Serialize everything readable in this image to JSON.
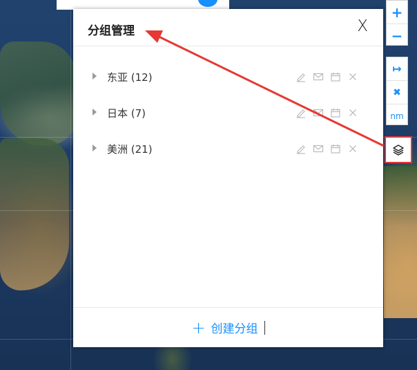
{
  "panel": {
    "title": "分组管理",
    "close_label": "X",
    "groups": [
      {
        "label": "东亚 (12)"
      },
      {
        "label": "日本 (7)"
      },
      {
        "label": "美洲 (21)"
      }
    ],
    "create_label": "创建分组"
  },
  "toolbar": {
    "zoom_in": "+",
    "zoom_out": "−",
    "measure": "↦",
    "clear": "✖",
    "unit": "nm"
  },
  "icons": {
    "edit": "pencil-icon",
    "mail": "mail-icon",
    "calendar": "calendar-icon",
    "delete": "close-icon",
    "layers": "layers-icon"
  },
  "colors": {
    "accent": "#1890ff",
    "annotation": "#e53935"
  }
}
